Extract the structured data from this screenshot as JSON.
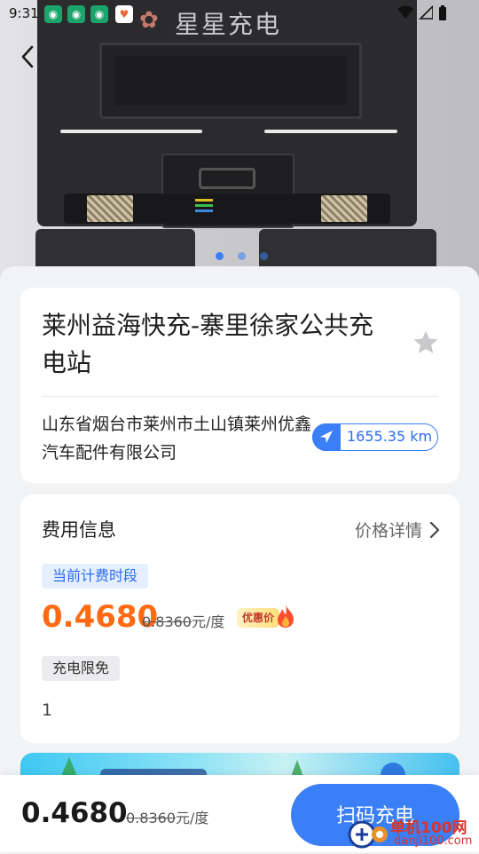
{
  "status_bar": {
    "time": "9:31"
  },
  "hero": {
    "brand_text": "星星充电",
    "page_dots": 3,
    "active_dot": 0
  },
  "station": {
    "name": "莱州益海快充-寨里徐家公共充电站",
    "address": "山东省烟台市莱州市土山镇莱州优鑫汽车配件有限公司",
    "distance": "1655.35 km"
  },
  "fee": {
    "title": "费用信息",
    "detail_link": "价格详情",
    "period_tag": "当前计费时段",
    "price": "0.4680",
    "original_price": "0.8360",
    "unit": "元/度",
    "promo_badge": "优惠价",
    "limit_tag": "充电限免",
    "limit_value": "1"
  },
  "bottom_bar": {
    "price": "0.4680",
    "original_price": "0.8360",
    "unit": "元/度",
    "scan_button": "扫码充电"
  },
  "watermark": {
    "text": "单机100网",
    "sub": "danji100.com"
  },
  "colors": {
    "accent": "#3b7ff6",
    "price_orange": "#ff6a13"
  }
}
